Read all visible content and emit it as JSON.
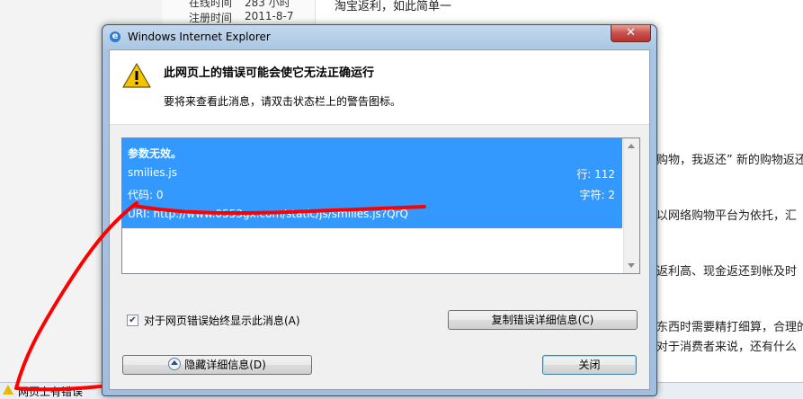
{
  "background": {
    "info_rows": [
      {
        "label": "在线时间",
        "value": "283 小时"
      },
      {
        "label": "注册时间",
        "value": "2011-8-7"
      }
    ],
    "text_lines": [
      "淘宝返利，如此简单一",
      "购物，我返还” 新的购物返还",
      "以网络购物平台为依托，汇",
      "返利高、现金返还到帐及时",
      "东西时需要精打细算，合理的",
      "对于消费者来说，还有什么"
    ],
    "statusbar_text": "网页上有错误"
  },
  "dialog": {
    "title": "Windows Internet Explorer",
    "close_symbol": "✕",
    "heading": "此网页上的错误可能会使它无法正确运行",
    "subtext": "要将来查看此消息，请双击状态栏上的警告图标。",
    "details": {
      "message": "参数无效。",
      "file": "smilies.js",
      "line_label": "行: 112",
      "code_label": "代码: 0",
      "char_label": "字符: 2",
      "uri_label": "URI: http://www.0553gx.com/static/js/smilies.js?QrQ"
    },
    "checkbox_label": "对于网页错误始终显示此消息(A)",
    "checkbox_checked": true,
    "copy_button": "复制错误详细信息(C)",
    "hide_button": "隐藏详细信息(D)",
    "close_button": "关闭"
  },
  "colors": {
    "selection": "#3399ff",
    "annotation_red": "#ff0000",
    "warning_yellow": "#f5c400"
  }
}
